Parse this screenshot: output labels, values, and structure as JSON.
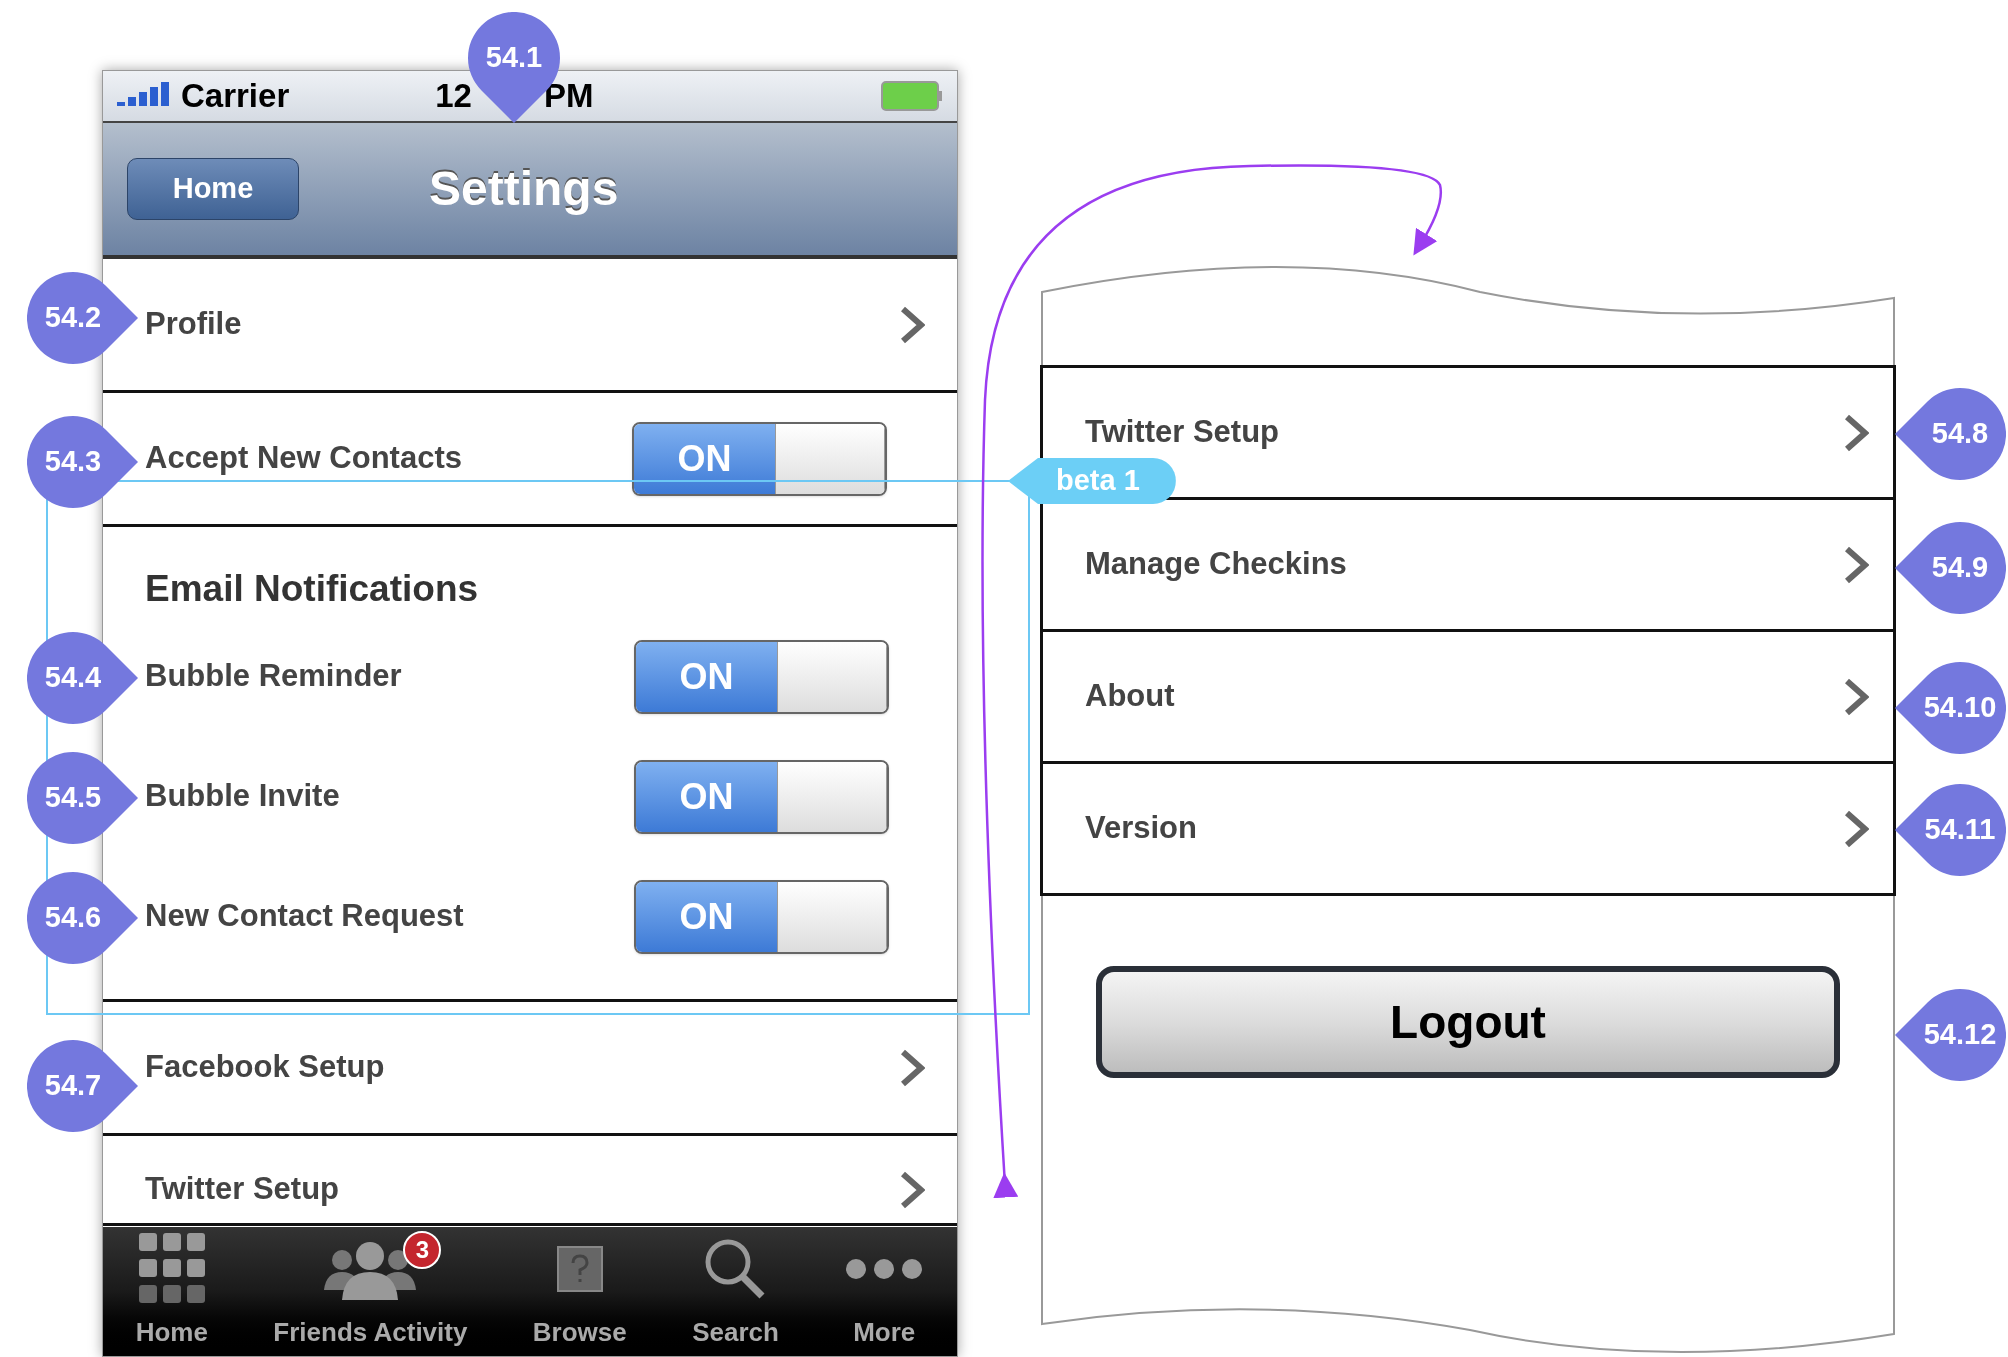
{
  "status_bar": {
    "carrier": "Carrier",
    "time_parts": [
      "12",
      "PM"
    ]
  },
  "nav_bar": {
    "back_button": "Home",
    "title": "Settings"
  },
  "settings_rows": [
    {
      "kind": "link",
      "label": "Profile"
    },
    {
      "kind": "toggle",
      "label": "Accept New Contacts",
      "on": true,
      "toggle_text": "ON"
    },
    {
      "kind": "section",
      "title": "Email Notifications",
      "items": [
        {
          "label": "Bubble Reminder",
          "on": true,
          "toggle_text": "ON"
        },
        {
          "label": "Bubble Invite",
          "on": true,
          "toggle_text": "ON"
        },
        {
          "label": "New Contact Request",
          "on": true,
          "toggle_text": "ON"
        }
      ]
    },
    {
      "kind": "link",
      "label": "Facebook Setup"
    },
    {
      "kind": "link",
      "label": "Twitter Setup"
    }
  ],
  "tab_bar": [
    {
      "label": "Home"
    },
    {
      "label": "Friends Activity",
      "badge": "3"
    },
    {
      "label": "Browse"
    },
    {
      "label": "Search"
    },
    {
      "label": "More"
    }
  ],
  "detail_rows": [
    {
      "label": "Twitter Setup"
    },
    {
      "label": "Manage Checkins"
    },
    {
      "label": "About"
    },
    {
      "label": "Version"
    }
  ],
  "logout_button": "Logout",
  "annotations": {
    "beta_tag": "beta 1",
    "markers": [
      {
        "label": "54.1",
        "kind": "top"
      },
      {
        "label": "54.2",
        "kind": "left"
      },
      {
        "label": "54.3",
        "kind": "left"
      },
      {
        "label": "54.4",
        "kind": "left"
      },
      {
        "label": "54.5",
        "kind": "left"
      },
      {
        "label": "54.6",
        "kind": "left"
      },
      {
        "label": "54.7",
        "kind": "left"
      },
      {
        "label": "54.8",
        "kind": "right"
      },
      {
        "label": "54.9",
        "kind": "right"
      },
      {
        "label": "54.10",
        "kind": "right"
      },
      {
        "label": "54.11",
        "kind": "right"
      },
      {
        "label": "54.12",
        "kind": "right"
      }
    ]
  }
}
